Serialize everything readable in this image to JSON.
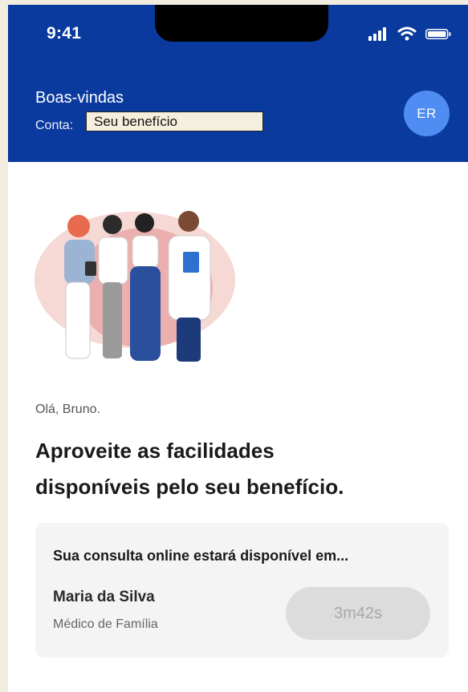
{
  "status_bar": {
    "time": "9:41",
    "icons": [
      "signal-icon",
      "wifi-icon",
      "battery-icon"
    ]
  },
  "header": {
    "title": "Boas-vindas",
    "account_label": "Conta:",
    "account_value": "Seu benefício",
    "avatar_initials": "ER"
  },
  "colors": {
    "header_bg": "#0a3a9e",
    "avatar_bg": "#4f8df2",
    "card_bg": "#f4f4f4",
    "countdown_bg": "#dcdcdc"
  },
  "main": {
    "illustration": "healthcare-team-illustration",
    "greeting": "Olá, Bruno.",
    "headline_line1": "Aproveite as facilidades",
    "headline_line2": "disponíveis pelo seu benefício."
  },
  "consult_card": {
    "title": "Sua consulta online estará disponível em...",
    "doctor_name": "Maria da Silva",
    "doctor_role": "Médico de Família",
    "countdown": "3m42s"
  }
}
